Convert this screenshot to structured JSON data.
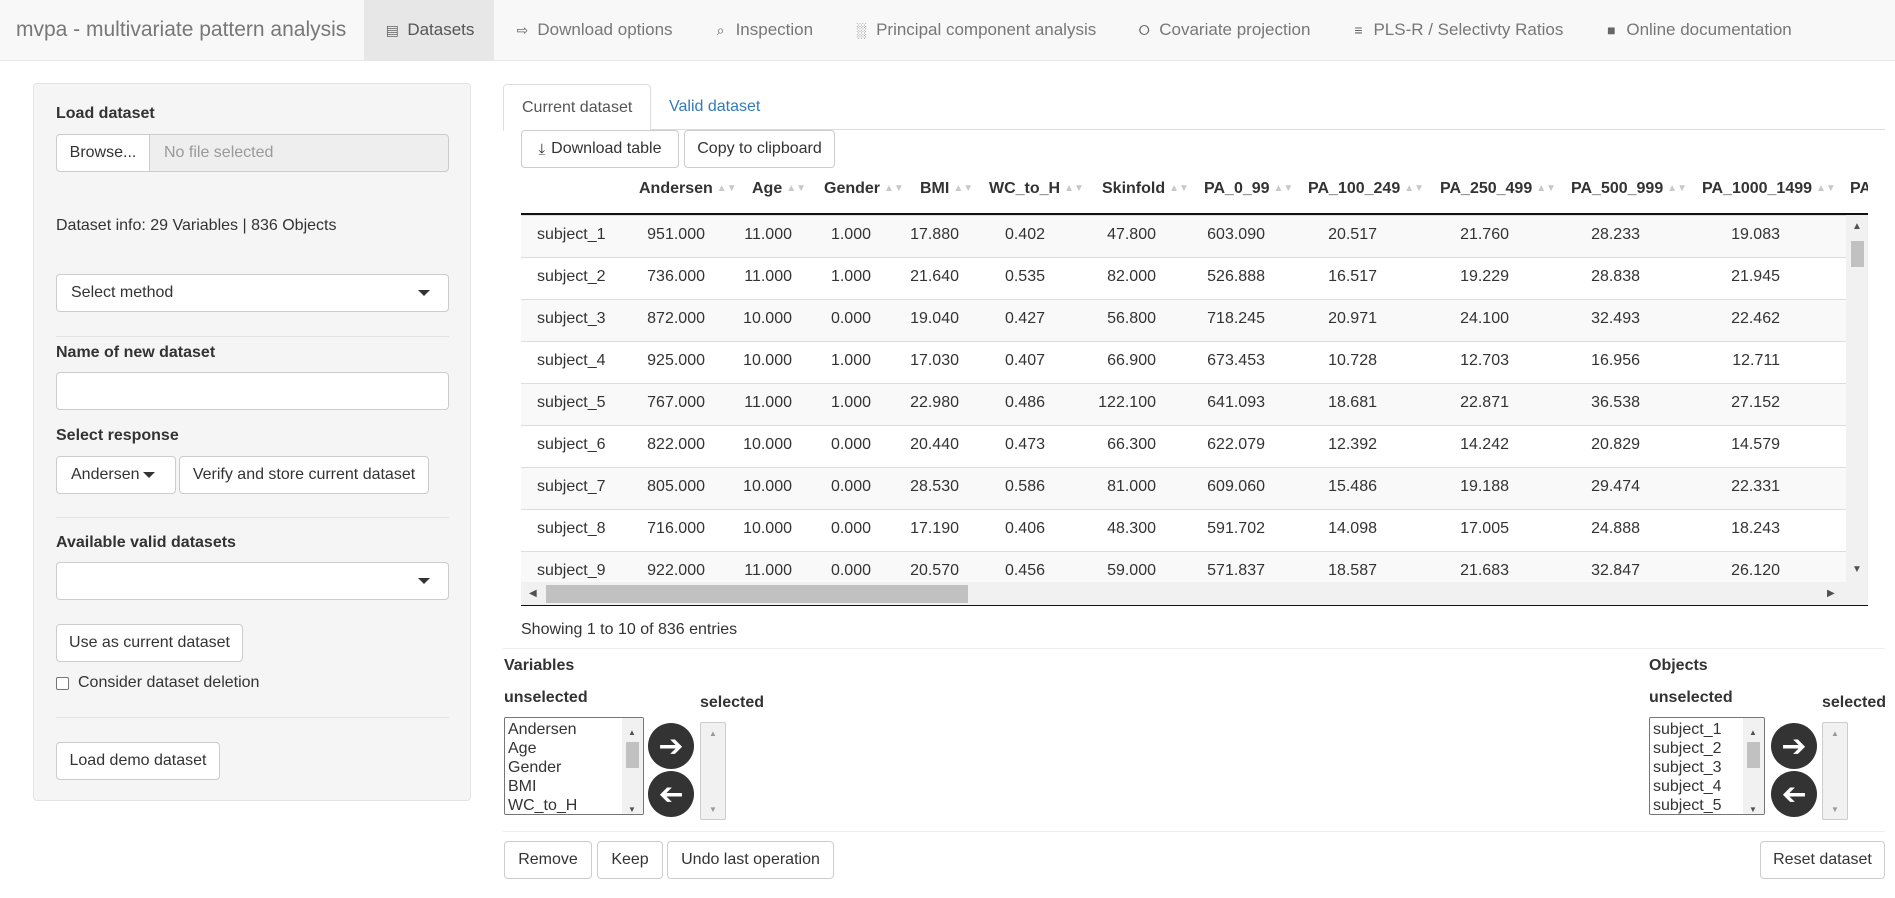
{
  "nav": {
    "brand": "mvpa - multivariate pattern analysis",
    "items": [
      {
        "label": "Datasets",
        "icon": "database-icon",
        "glyph": "▤"
      },
      {
        "label": "Download options",
        "icon": "file-export-icon",
        "glyph": "⇨"
      },
      {
        "label": "Inspection",
        "icon": "search-icon",
        "glyph": "⌕"
      },
      {
        "label": "Principal component analysis",
        "icon": "grid-icon",
        "glyph": "░"
      },
      {
        "label": "Covariate projection",
        "icon": "project-diagram-icon",
        "glyph": "⭘"
      },
      {
        "label": "PLS-R / Selectivty Ratios",
        "icon": "chart-bar-icon",
        "glyph": "≡"
      },
      {
        "label": "Online documentation",
        "icon": "book-icon",
        "glyph": "■"
      }
    ]
  },
  "sidebar": {
    "load_label": "Load dataset",
    "browse_label": "Browse...",
    "file_placeholder": "No file selected",
    "dataset_info": "Dataset info: 29 Variables | 836 Objects",
    "method_select": "Select method",
    "new_name_label": "Name of new dataset",
    "new_name_value": "",
    "response_label": "Select response",
    "response_value": "Andersen",
    "verify_button": "Verify and store current dataset",
    "valid_datasets_label": "Available valid datasets",
    "valid_datasets_value": "",
    "use_current_button": "Use as current dataset",
    "consider_deletion": "Consider dataset deletion",
    "demo_button": "Load demo dataset"
  },
  "main": {
    "tabs": [
      "Current dataset",
      "Valid dataset"
    ],
    "download_table": "Download table",
    "copy_clipboard": "Copy to clipboard",
    "columns": [
      "",
      "Andersen",
      "Age",
      "Gender",
      "BMI",
      "WC_to_H",
      "Skinfold",
      "PA_0_99",
      "PA_100_249",
      "PA_250_499",
      "PA_500_999",
      "PA_1000_1499",
      "PA"
    ],
    "rows": [
      [
        "subject_1",
        "951.000",
        "11.000",
        "1.000",
        "17.880",
        "0.402",
        "47.800",
        "603.090",
        "20.517",
        "21.760",
        "28.233",
        "19.083"
      ],
      [
        "subject_2",
        "736.000",
        "11.000",
        "1.000",
        "21.640",
        "0.535",
        "82.000",
        "526.888",
        "16.517",
        "19.229",
        "28.838",
        "21.945"
      ],
      [
        "subject_3",
        "872.000",
        "10.000",
        "0.000",
        "19.040",
        "0.427",
        "56.800",
        "718.245",
        "20.971",
        "24.100",
        "32.493",
        "22.462"
      ],
      [
        "subject_4",
        "925.000",
        "10.000",
        "1.000",
        "17.030",
        "0.407",
        "66.900",
        "673.453",
        "10.728",
        "12.703",
        "16.956",
        "12.711"
      ],
      [
        "subject_5",
        "767.000",
        "11.000",
        "1.000",
        "22.980",
        "0.486",
        "122.100",
        "641.093",
        "18.681",
        "22.871",
        "36.538",
        "27.152"
      ],
      [
        "subject_6",
        "822.000",
        "10.000",
        "0.000",
        "20.440",
        "0.473",
        "66.300",
        "622.079",
        "12.392",
        "14.242",
        "20.829",
        "14.579"
      ],
      [
        "subject_7",
        "805.000",
        "10.000",
        "0.000",
        "28.530",
        "0.586",
        "81.000",
        "609.060",
        "15.486",
        "19.188",
        "29.474",
        "22.331"
      ],
      [
        "subject_8",
        "716.000",
        "10.000",
        "0.000",
        "17.190",
        "0.406",
        "48.300",
        "591.702",
        "14.098",
        "17.005",
        "24.888",
        "18.243"
      ],
      [
        "subject_9",
        "922.000",
        "11.000",
        "0.000",
        "20.570",
        "0.456",
        "59.000",
        "571.837",
        "18.587",
        "21.683",
        "32.847",
        "26.120"
      ]
    ],
    "entries_info": "Showing 1 to 10 of 836 entries",
    "variables": {
      "title": "Variables",
      "unselected_label": "unselected",
      "selected_label": "selected",
      "items": [
        "Andersen",
        "Age",
        "Gender",
        "BMI",
        "WC_to_H"
      ]
    },
    "objects": {
      "title": "Objects",
      "unselected_label": "unselected",
      "selected_label": "selected",
      "items": [
        "subject_1",
        "subject_2",
        "subject_3",
        "subject_4",
        "subject_5"
      ]
    },
    "remove_button": "Remove",
    "keep_button": "Keep",
    "undo_button": "Undo last operation",
    "reset_button": "Reset dataset"
  }
}
